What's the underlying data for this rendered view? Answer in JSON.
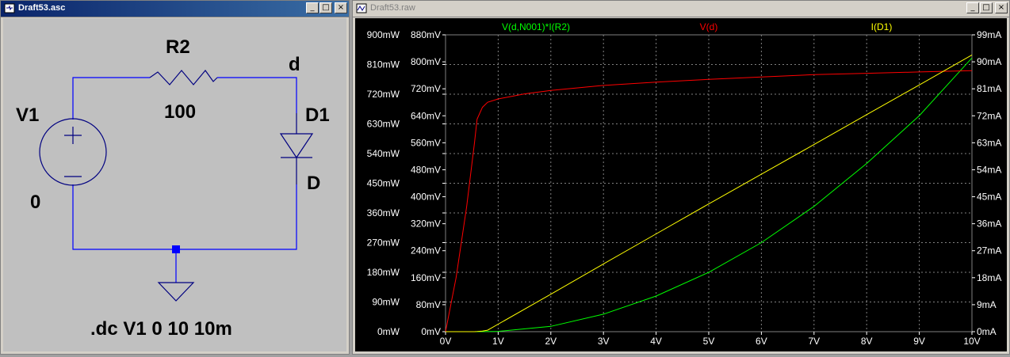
{
  "schematic_window": {
    "title": "Draft53.asc",
    "controls": {
      "minimize": "_",
      "maximize": "□",
      "close": "×"
    },
    "labels": {
      "source_name": "V1",
      "source_node": "0",
      "resistor_name": "R2",
      "resistor_value": "100",
      "net_label": "d",
      "diode_name": "D1",
      "diode_model": "D",
      "directive": ".dc V1 0 10 10m"
    },
    "colors": {
      "wire": "#0000ff",
      "component": "#000080",
      "background": "#c0c0c0"
    }
  },
  "waveform_window": {
    "title": "Draft53.raw",
    "controls": {
      "minimize": "_",
      "maximize": "□",
      "close": "×"
    },
    "colors": {
      "background": "#000000",
      "grid": "#808080",
      "axis_text": "#ffffff"
    },
    "chart_data": {
      "type": "line",
      "x_range": [
        0,
        10
      ],
      "x_ticks": [
        "0V",
        "1V",
        "2V",
        "3V",
        "4V",
        "5V",
        "6V",
        "7V",
        "8V",
        "9V",
        "10V"
      ],
      "y_left_power_range_mW": [
        0,
        900
      ],
      "y_left_power_ticks": [
        "0mW",
        "90mW",
        "180mW",
        "270mW",
        "360mW",
        "450mW",
        "540mW",
        "630mW",
        "720mW",
        "810mW",
        "900mW"
      ],
      "y_left_voltage_range_mV": [
        0,
        880
      ],
      "y_left_voltage_ticks": [
        "0mV",
        "80mV",
        "160mV",
        "240mV",
        "320mV",
        "400mV",
        "480mV",
        "560mV",
        "640mV",
        "720mV",
        "800mV",
        "880mV"
      ],
      "y_right_current_range_mA": [
        0,
        99
      ],
      "y_right_current_ticks": [
        "0mA",
        "9mA",
        "18mA",
        "27mA",
        "36mA",
        "45mA",
        "54mA",
        "63mA",
        "72mA",
        "81mA",
        "90mA",
        "99mA"
      ],
      "series": [
        {
          "name": "V(d,N001)*I(R2)",
          "color": "#00ff00",
          "axis": "power_mW",
          "x": [
            0,
            0.6,
            1,
            2,
            3,
            4,
            5,
            6,
            7,
            8,
            9,
            10
          ],
          "y": [
            0,
            0,
            1,
            16,
            53,
            108,
            180,
            270,
            380,
            510,
            655,
            830
          ]
        },
        {
          "name": "V(d)",
          "color": "#ff0000",
          "axis": "voltage_mV",
          "x": [
            0,
            0.2,
            0.4,
            0.55,
            0.6,
            0.7,
            0.8,
            1,
            1.5,
            2,
            3,
            4,
            5,
            6,
            7,
            8,
            9,
            10
          ],
          "y": [
            0,
            160,
            370,
            560,
            630,
            665,
            680,
            690,
            705,
            715,
            730,
            740,
            748,
            755,
            762,
            766,
            770,
            774
          ]
        },
        {
          "name": "I(D1)",
          "color": "#ffff00",
          "axis": "current_mA",
          "x": [
            0,
            0.55,
            0.6,
            0.7,
            0.8,
            1,
            2,
            3,
            4,
            5,
            6,
            7,
            8,
            9,
            10
          ],
          "y": [
            0,
            0,
            0.05,
            0.2,
            0.5,
            2.5,
            12.5,
            22.6,
            32.6,
            42.6,
            52.5,
            62.4,
            72.4,
            82.3,
            92.3
          ]
        }
      ]
    }
  }
}
